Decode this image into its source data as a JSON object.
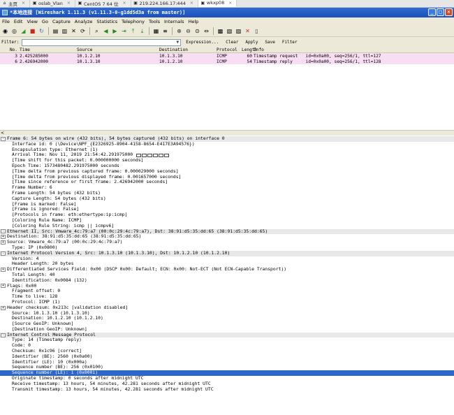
{
  "browser_tabs": [
    {
      "label": "主页",
      "icon": "home-icon",
      "active": false
    },
    {
      "label": "oslab_Vlan",
      "icon": "console-icon",
      "active": false
    },
    {
      "label": "CentOS 7 64 位",
      "icon": "console-icon",
      "active": false
    },
    {
      "label": "219.224.166.17:444",
      "icon": "console-icon",
      "active": false
    },
    {
      "label": "wkxp08",
      "icon": "console-icon",
      "active": true
    }
  ],
  "window": {
    "title": "*本地连接  [Wireshark 1.11.3  (v1.11.3-0-g1dd5d3a from master)]"
  },
  "menu": [
    "File",
    "Edit",
    "View",
    "Go",
    "Capture",
    "Analyze",
    "Statistics",
    "Telephony",
    "Tools",
    "Internals",
    "Help"
  ],
  "toolbar_icons": [
    "interfaces-icon",
    "options-icon",
    "start-capture-icon",
    "stop-capture-icon",
    "restart-capture-icon",
    "open-file-icon",
    "save-file-icon",
    "close-file-icon",
    "reload-icon",
    "find-icon",
    "back-icon",
    "forward-icon",
    "go-to-packet-icon",
    "first-packet-icon",
    "last-packet-icon",
    "colorize-icon",
    "autoscroll-icon",
    "zoom-in-icon",
    "zoom-out-icon",
    "normal-size-icon",
    "resize-columns-icon",
    "capture-filters-icon",
    "display-filters-icon",
    "coloring-rules-icon",
    "preferences-icon",
    "help-icon"
  ],
  "filter": {
    "label": "Filter:",
    "value": "",
    "expression": "Expression...",
    "clear": "Clear",
    "apply": "Apply",
    "save": "Save",
    "filter_btn": "Filter"
  },
  "packet_list": {
    "columns": [
      "No.",
      "Time",
      "Source",
      "Destination",
      "Protocol",
      "Length",
      "Info"
    ],
    "rows": [
      {
        "no": "3",
        "time": "2.425285000",
        "src": "10.1.2.10",
        "dst": "10.1.3.10",
        "proto": "ICMP",
        "len": "60",
        "info": "Timestamp request   id=0x0a00, seq=256/1, ttl=127"
      },
      {
        "no": "6",
        "time": "2.426942000",
        "src": "10.1.3.10",
        "dst": "10.1.2.10",
        "proto": "ICMP",
        "len": "54",
        "info": "Timestamp reply     id=0x0a00, seq=256/1, ttl=128"
      }
    ]
  },
  "details": [
    {
      "t": "Frame 6: 54 bytes on wire (432 bits), 54 bytes captured (432 bits) on interface 0",
      "lvl": 0,
      "hdr": true,
      "tg": "-"
    },
    {
      "t": "Interface id: 0 (\\Device\\NPF_{E2326925-8904-4158-8654-E417E3A94576})",
      "lvl": 1
    },
    {
      "t": "Encapsulation type: Ethernet (1)",
      "lvl": 1
    },
    {
      "t": "Arrival Time: Nov 11, 2019 21:54:42.291975000 ",
      "lvl": 1,
      "sq": 6
    },
    {
      "t": "[Time shift for this packet: 0.000000000 seconds]",
      "lvl": 1
    },
    {
      "t": "Epoch Time: 1573480482.291975000 seconds",
      "lvl": 1
    },
    {
      "t": "[Time delta from previous captured frame: 0.000029000 seconds]",
      "lvl": 1
    },
    {
      "t": "[Time delta from previous displayed frame: 0.001657000 seconds]",
      "lvl": 1
    },
    {
      "t": "[Time since reference or first frame: 2.426942000 seconds]",
      "lvl": 1
    },
    {
      "t": "Frame Number: 6",
      "lvl": 1
    },
    {
      "t": "Frame Length: 54 bytes (432 bits)",
      "lvl": 1
    },
    {
      "t": "Capture Length: 54 bytes (432 bits)",
      "lvl": 1
    },
    {
      "t": "[Frame is marked: False]",
      "lvl": 1
    },
    {
      "t": "[Frame is ignored: False]",
      "lvl": 1
    },
    {
      "t": "[Protocols in frame: eth:ethertype:ip:icmp]",
      "lvl": 1
    },
    {
      "t": "[Coloring Rule Name: ICMP]",
      "lvl": 1
    },
    {
      "t": "[Coloring Rule String: icmp || icmpv6]",
      "lvl": 1
    },
    {
      "t": "Ethernet II, Src: Vmware_4c:79:a7 (00:0c:29:4c:79:a7), Dst: 38:91:d5:35:dd:65 (38:91:d5:35:dd:65)",
      "lvl": 0,
      "hdr": true,
      "tg": "-"
    },
    {
      "t": "Destination: 38:91:d5:35:dd:65 (38:91:d5:35:dd:65)",
      "lvl": 0,
      "tg": "+"
    },
    {
      "t": "Source: Vmware_4c:79:a7 (00:0c:29:4c:79:a7)",
      "lvl": 0,
      "tg": "+"
    },
    {
      "t": "Type: IP (0x0800)",
      "lvl": 1
    },
    {
      "t": "Internet Protocol Version 4, Src: 10.1.3.10 (10.1.3.10), Dst: 10.1.2.10 (10.1.2.10)",
      "lvl": 0,
      "hdr": true,
      "tg": "-"
    },
    {
      "t": "Version: 4",
      "lvl": 1
    },
    {
      "t": "Header Length: 20 bytes",
      "lvl": 1
    },
    {
      "t": "Differentiated Services Field: 0x00 (DSCP 0x00: Default; ECN: 0x00: Not-ECT (Not ECN-Capable Transport))",
      "lvl": 0,
      "tg": "+"
    },
    {
      "t": "Total Length: 40",
      "lvl": 1
    },
    {
      "t": "Identification: 0x0084 (132)",
      "lvl": 1
    },
    {
      "t": "Flags: 0x00",
      "lvl": 0,
      "tg": "+"
    },
    {
      "t": "Fragment offset: 0",
      "lvl": 1
    },
    {
      "t": "Time to live: 128",
      "lvl": 1
    },
    {
      "t": "Protocol: ICMP (1)",
      "lvl": 1
    },
    {
      "t": "Header checksum: 0x213c [validation disabled]",
      "lvl": 0,
      "tg": "+"
    },
    {
      "t": "Source: 10.1.3.10 (10.1.3.10)",
      "lvl": 1
    },
    {
      "t": "Destination: 10.1.2.10 (10.1.2.10)",
      "lvl": 1
    },
    {
      "t": "[Source GeoIP: Unknown]",
      "lvl": 1
    },
    {
      "t": "[Destination GeoIP: Unknown]",
      "lvl": 1
    },
    {
      "t": "Internet Control Message Protocol",
      "lvl": 0,
      "hdr": true,
      "tg": "-"
    },
    {
      "t": "Type: 14 (Timestamp reply)",
      "lvl": 1
    },
    {
      "t": "Code: 0",
      "lvl": 1
    },
    {
      "t": "Checksum: 0x1c96 [correct]",
      "lvl": 1
    },
    {
      "t": "Identifier (BE): 2560 (0x0a00)",
      "lvl": 1
    },
    {
      "t": "Identifier (LE): 10 (0x000a)",
      "lvl": 1
    },
    {
      "t": "Sequence number (BE): 256 (0x0100)",
      "lvl": 1
    },
    {
      "t": "Sequence number (LE): 1 (0x0001)",
      "lvl": 1,
      "sel": true
    },
    {
      "t": "Originate timestamp: 0 seconds after midnight UTC",
      "lvl": 1
    },
    {
      "t": "Receive timestamp: 13 hours, 54 minutes, 42.281 seconds after midnight UTC",
      "lvl": 1
    },
    {
      "t": "Transmit timestamp: 13 hours, 54 minutes, 42.281 seconds after midnight UTC",
      "lvl": 1
    }
  ],
  "colors": {
    "title_bar": "#1d4fb8",
    "selected_row": "#2f67c9",
    "icmp_row": "#f7def2"
  }
}
